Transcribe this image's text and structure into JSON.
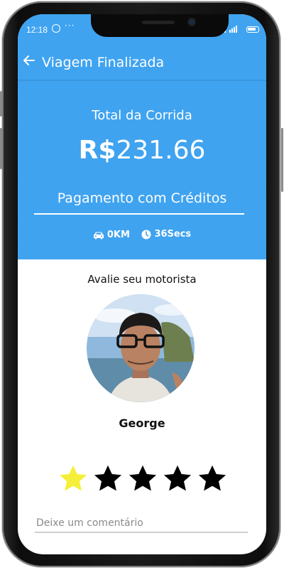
{
  "status_bar": {
    "time": "12:18",
    "dots": "···"
  },
  "app_bar": {
    "title": "Viagem Finalizada"
  },
  "summary": {
    "total_label": "Total da Corrida",
    "currency": "R$",
    "total_amount": "231.66",
    "payment_method": "Pagamento com Créditos",
    "distance": "0KM",
    "duration": "36Secs"
  },
  "rating": {
    "prompt": "Avalie seu motorista",
    "driver_name": "George",
    "value": 1,
    "max": 5,
    "filled_color": "#f5ef3a",
    "empty_color": "#000000"
  },
  "comment": {
    "placeholder": "Deixe um comentário",
    "value": ""
  },
  "colors": {
    "primary": "#3fa3f0",
    "text_on_primary": "#ffffff"
  }
}
